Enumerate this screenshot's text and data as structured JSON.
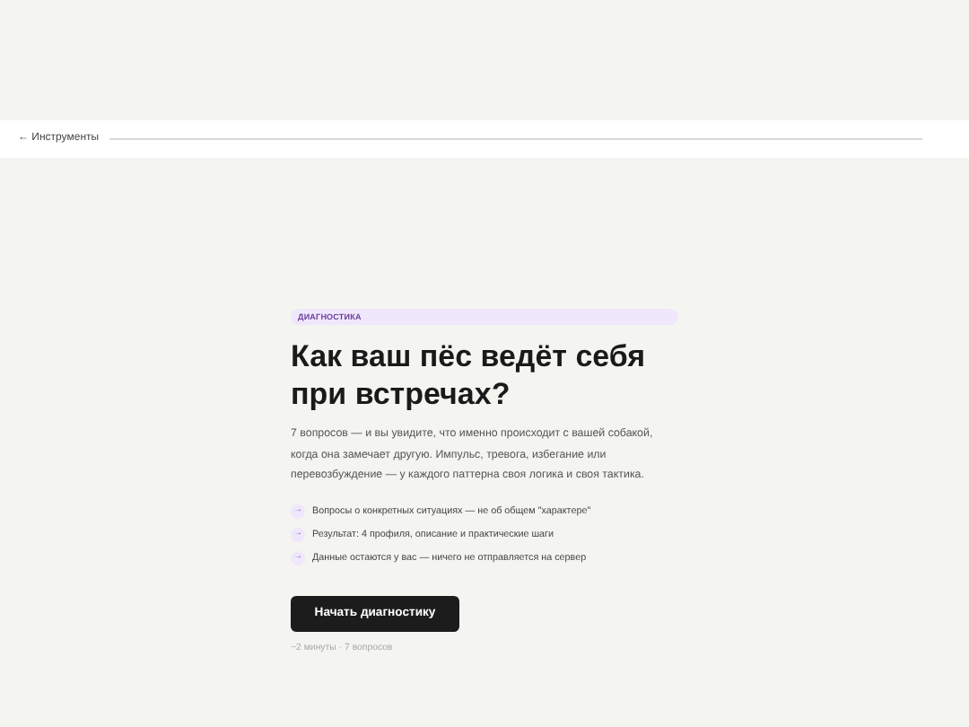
{
  "nav": {
    "back_link": "← Инструменты"
  },
  "badge": "ДИАГНОСТИКА",
  "title": "Как ваш пёс ведёт себя при встречах?",
  "description": "7 вопросов — и вы увидите, что именно происходит с вашей собакой, когда она замечает другую. Импульс, тревога, избегание или перевозбуждение — у каждого паттерна своя логика и своя тактика.",
  "features": [
    {
      "marker": "→",
      "text": "Вопросы о конкретных ситуациях — не об общем \"характере\""
    },
    {
      "marker": "→",
      "text": "Результат: 4 профиля, описание и практические шаги"
    },
    {
      "marker": "→",
      "text": "Данные остаются у вас — ничего не отправляется на сервер"
    }
  ],
  "start_button": "Начать диагностику",
  "meta": "~2 минуты · 7 вопросов"
}
